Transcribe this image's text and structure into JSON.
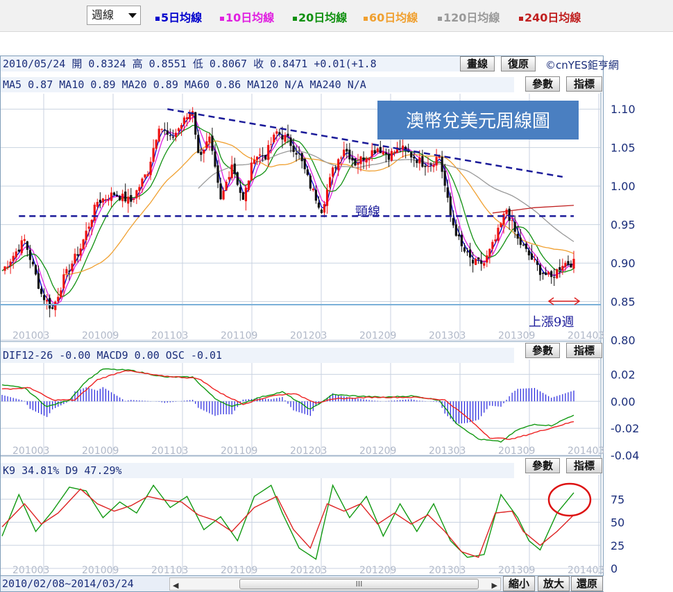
{
  "toolbar": {
    "period_select": "週線",
    "legend": [
      {
        "label": "5日均線",
        "color": "#0000cc"
      },
      {
        "label": "10日均線",
        "color": "#e020e0"
      },
      {
        "label": "20日均線",
        "color": "#109010"
      },
      {
        "label": "60日均線",
        "color": "#f0a030"
      },
      {
        "label": "120日均線",
        "color": "#999999"
      },
      {
        "label": "240日均線",
        "color": "#c02020"
      }
    ]
  },
  "header": {
    "quote": "2010/05/24 開 0.8324 高 0.8551 低 0.8067 收 0.8471 +0.01(+1.8",
    "draw_button": "畫線",
    "reset_button": "復原",
    "copyright": "©cnYES鉅亨網",
    "ma_line": "MA5 0.87   MA10 0.89   MA20 0.89   MA60 0.86   MA120 N/A   MA240 N/A",
    "params_button": "參數",
    "indicator_button": "指標"
  },
  "macd_header": {
    "text": "DIF12-26 -0.00   MACD9 0.00   OSC -0.01",
    "params_button": "參數",
    "indicator_button": "指標"
  },
  "kd_header": {
    "text": "K9 34.81%   D9 47.29%",
    "params_button": "參數",
    "indicator_button": "指標"
  },
  "footer": {
    "range": "2010/02/08~2014/03/24",
    "thumb_grip": "III",
    "left_arrow": "◀",
    "right_arrow": "▶",
    "zoom_out": "縮小",
    "zoom_in": "放大",
    "restore": "還原"
  },
  "annotations": {
    "title": "澳幣兌美元周線圖",
    "neckline": "頸線",
    "rise": "上漲9週"
  },
  "colors": {
    "candle_up": "#ee1111",
    "candle_down": "#111111",
    "trendline": "#1a1a99",
    "dif": "#119911",
    "macd": "#ee2222",
    "osc": "#2222dd",
    "k": "#119911",
    "d": "#dd2222",
    "axis_text": "#1a2d7a",
    "title_box": "#4a7fc1"
  },
  "chart_data": [
    {
      "type": "candlestick",
      "title": "澳幣兌美元周線圖",
      "ylim": [
        0.8,
        1.12
      ],
      "yticks": [
        "1.10",
        "1.05",
        "1.00",
        "0.95",
        "0.90",
        "0.85",
        "0.80"
      ],
      "x_tick_labels": [
        "201003",
        "201009",
        "201103",
        "201109",
        "201203",
        "201209",
        "201303",
        "201309",
        "201403"
      ],
      "close_path": [
        [
          0,
          0.89
        ],
        [
          8,
          0.93
        ],
        [
          14,
          0.86
        ],
        [
          18,
          0.84
        ],
        [
          22,
          0.88
        ],
        [
          28,
          0.92
        ],
        [
          34,
          0.98
        ],
        [
          40,
          0.99
        ],
        [
          46,
          0.98
        ],
        [
          52,
          1.02
        ],
        [
          56,
          1.08
        ],
        [
          60,
          1.06
        ],
        [
          64,
          1.08
        ],
        [
          68,
          1.1
        ],
        [
          70,
          1.04
        ],
        [
          74,
          1.06
        ],
        [
          78,
          0.98
        ],
        [
          82,
          1.03
        ],
        [
          86,
          0.98
        ],
        [
          90,
          1.04
        ],
        [
          94,
          1.04
        ],
        [
          98,
          1.07
        ],
        [
          102,
          1.06
        ],
        [
          106,
          1.04
        ],
        [
          110,
          1.0
        ],
        [
          114,
          0.97
        ],
        [
          118,
          1.02
        ],
        [
          122,
          1.05
        ],
        [
          126,
          1.03
        ],
        [
          130,
          1.04
        ],
        [
          134,
          1.05
        ],
        [
          138,
          1.04
        ],
        [
          142,
          1.05
        ],
        [
          146,
          1.04
        ],
        [
          150,
          1.03
        ],
        [
          153,
          1.03
        ],
        [
          156,
          1.04
        ],
        [
          160,
          0.96
        ],
        [
          164,
          0.92
        ],
        [
          168,
          0.9
        ],
        [
          172,
          0.9
        ],
        [
          176,
          0.93
        ],
        [
          180,
          0.97
        ],
        [
          184,
          0.93
        ],
        [
          188,
          0.91
        ],
        [
          192,
          0.89
        ],
        [
          196,
          0.88
        ],
        [
          200,
          0.9
        ],
        [
          204,
          0.9
        ]
      ],
      "series": [
        {
          "name": "5日均線",
          "smooth": 2
        },
        {
          "name": "10日均線",
          "smooth": 4
        },
        {
          "name": "20日均線",
          "smooth": 9
        },
        {
          "name": "60日均線",
          "smooth": 26,
          "start": 22
        },
        {
          "name": "120日均線",
          "smooth": 50,
          "start": 70
        },
        {
          "name": "240日均線",
          "values": [
            [
              175,
              0.965
            ],
            [
              190,
              0.972
            ],
            [
              204,
              0.975
            ]
          ]
        }
      ],
      "trendlines": [
        {
          "kind": "resistance",
          "from": [
            59,
            1.1
          ],
          "to": [
            200,
            1.012
          ]
        },
        {
          "kind": "neckline",
          "from": [
            6,
            0.961
          ],
          "to": [
            204,
            0.961
          ]
        },
        {
          "kind": "support",
          "from": [
            0,
            0.846
          ],
          "to": [
            210,
            0.846
          ]
        }
      ]
    },
    {
      "type": "line",
      "ylim": [
        -0.04,
        0.03
      ],
      "yticks": [
        "0.02",
        "0.00",
        "-0.02",
        "-0.04"
      ],
      "series": [
        {
          "name": "DIF12-26",
          "values": [
            [
              0,
              0.012
            ],
            [
              8,
              0.01
            ],
            [
              16,
              -0.004
            ],
            [
              24,
              0.001
            ],
            [
              30,
              0.015
            ],
            [
              36,
              0.024
            ],
            [
              46,
              0.023
            ],
            [
              58,
              0.018
            ],
            [
              68,
              0.018
            ],
            [
              76,
              0.002
            ],
            [
              82,
              -0.004
            ],
            [
              92,
              0.003
            ],
            [
              100,
              0.007
            ],
            [
              110,
              -0.006
            ],
            [
              118,
              0.005
            ],
            [
              126,
              0.004
            ],
            [
              136,
              0.003
            ],
            [
              146,
              0.004
            ],
            [
              156,
              0.001
            ],
            [
              162,
              -0.016
            ],
            [
              170,
              -0.028
            ],
            [
              178,
              -0.03
            ],
            [
              184,
              -0.021
            ],
            [
              190,
              -0.017
            ],
            [
              196,
              -0.018
            ],
            [
              204,
              -0.01
            ]
          ]
        },
        {
          "name": "MACD9",
          "values": [
            [
              0,
              0.009
            ],
            [
              10,
              0.01
            ],
            [
              18,
              0.001
            ],
            [
              26,
              0.001
            ],
            [
              34,
              0.016
            ],
            [
              44,
              0.023
            ],
            [
              56,
              0.019
            ],
            [
              70,
              0.017
            ],
            [
              78,
              0.006
            ],
            [
              86,
              -0.002
            ],
            [
              96,
              0.004
            ],
            [
              104,
              0.006
            ],
            [
              112,
              -0.001
            ],
            [
              120,
              0.002
            ],
            [
              132,
              0.003
            ],
            [
              148,
              0.003
            ],
            [
              158,
              0.001
            ],
            [
              166,
              -0.012
            ],
            [
              174,
              -0.027
            ],
            [
              182,
              -0.028
            ],
            [
              192,
              -0.022
            ],
            [
              204,
              -0.015
            ]
          ]
        },
        {
          "name": "OSC",
          "bars": true
        }
      ]
    },
    {
      "type": "line",
      "ylim": [
        0,
        100
      ],
      "yticks": [
        "75",
        "50",
        "25",
        "0"
      ],
      "series": [
        {
          "name": "K9",
          "values": [
            [
              0,
              35
            ],
            [
              6,
              80
            ],
            [
              12,
              40
            ],
            [
              18,
              62
            ],
            [
              24,
              88
            ],
            [
              30,
              84
            ],
            [
              36,
              55
            ],
            [
              42,
              72
            ],
            [
              48,
              60
            ],
            [
              54,
              90
            ],
            [
              60,
              66
            ],
            [
              66,
              78
            ],
            [
              72,
              42
            ],
            [
              78,
              56
            ],
            [
              84,
              30
            ],
            [
              90,
              78
            ],
            [
              96,
              90
            ],
            [
              100,
              60
            ],
            [
              106,
              22
            ],
            [
              112,
              10
            ],
            [
              118,
              90
            ],
            [
              124,
              55
            ],
            [
              130,
              78
            ],
            [
              136,
              35
            ],
            [
              142,
              70
            ],
            [
              148,
              40
            ],
            [
              154,
              70
            ],
            [
              160,
              30
            ],
            [
              166,
              12
            ],
            [
              172,
              15
            ],
            [
              178,
              80
            ],
            [
              184,
              55
            ],
            [
              188,
              30
            ],
            [
              192,
              20
            ],
            [
              198,
              60
            ],
            [
              204,
              82
            ]
          ]
        },
        {
          "name": "D9",
          "values": [
            [
              0,
              45
            ],
            [
              8,
              70
            ],
            [
              14,
              48
            ],
            [
              20,
              60
            ],
            [
              28,
              86
            ],
            [
              34,
              70
            ],
            [
              40,
              62
            ],
            [
              46,
              68
            ],
            [
              52,
              78
            ],
            [
              58,
              74
            ],
            [
              64,
              72
            ],
            [
              70,
              58
            ],
            [
              76,
              52
            ],
            [
              82,
              40
            ],
            [
              90,
              66
            ],
            [
              98,
              78
            ],
            [
              104,
              42
            ],
            [
              110,
              22
            ],
            [
              116,
              70
            ],
            [
              122,
              62
            ],
            [
              128,
              70
            ],
            [
              134,
              48
            ],
            [
              140,
              60
            ],
            [
              146,
              48
            ],
            [
              152,
              58
            ],
            [
              158,
              40
            ],
            [
              164,
              18
            ],
            [
              170,
              12
            ],
            [
              176,
              60
            ],
            [
              182,
              62
            ],
            [
              186,
              40
            ],
            [
              192,
              25
            ],
            [
              198,
              40
            ],
            [
              204,
              58
            ]
          ]
        }
      ]
    }
  ]
}
